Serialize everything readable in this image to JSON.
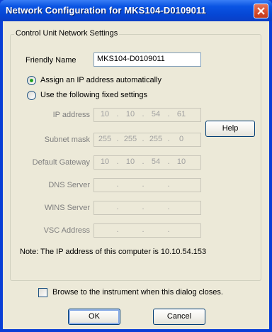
{
  "window": {
    "title": "Network Configuration for MKS104-D0109011"
  },
  "group": {
    "label": "Control Unit Network Settings"
  },
  "friendly_name": {
    "label": "Friendly Name",
    "value": "MKS104-D0109011"
  },
  "options": {
    "auto": {
      "label": "Assign an IP address automatically",
      "selected": true
    },
    "fixed": {
      "label": "Use the following fixed settings",
      "selected": false
    }
  },
  "fields": {
    "ip": {
      "label": "IP address",
      "octets": [
        "10",
        "10",
        "54",
        "61"
      ]
    },
    "subnet": {
      "label": "Subnet mask",
      "octets": [
        "255",
        "255",
        "255",
        "0"
      ]
    },
    "gateway": {
      "label": "Default Gateway",
      "octets": [
        "10",
        "10",
        "54",
        "10"
      ]
    },
    "dns": {
      "label": "DNS Server",
      "octets": [
        "",
        "",
        "",
        ""
      ]
    },
    "wins": {
      "label": "WINS Server",
      "octets": [
        "",
        "",
        "",
        ""
      ]
    },
    "vsc": {
      "label": "VSC Address",
      "octets": [
        "",
        "",
        "",
        ""
      ]
    }
  },
  "help_button": "Help",
  "note": "Note:  The IP address of this computer is 10.10.54.153",
  "browse": {
    "label": "Browse to the instrument when this dialog closes.",
    "checked": false
  },
  "buttons": {
    "ok": "OK",
    "cancel": "Cancel"
  },
  "colors": {
    "titlebar": "#0a54e3",
    "dialog_bg": "#ece9d8",
    "close": "#d44a2a",
    "radio_dot": "#21a121"
  }
}
